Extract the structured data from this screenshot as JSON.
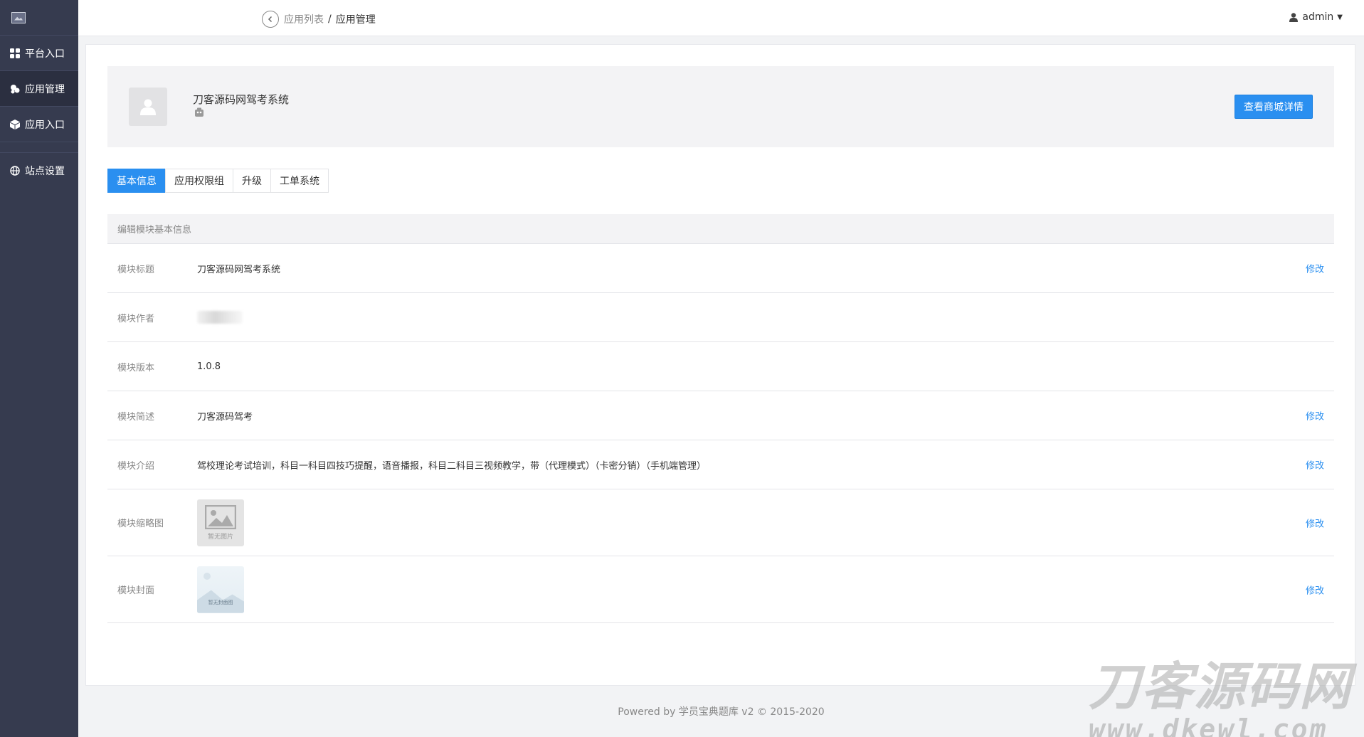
{
  "sidebar": {
    "logo_icon": "image-icon",
    "items": [
      {
        "label": "平台入口",
        "icon": "grid-icon",
        "active": false
      },
      {
        "label": "应用管理",
        "icon": "cubes-icon",
        "active": true
      },
      {
        "label": "应用入口",
        "icon": "cube-icon",
        "active": false
      },
      {
        "label": "站点设置",
        "icon": "globe-icon",
        "active": false
      }
    ]
  },
  "topbar": {
    "breadcrumb": {
      "back_icon": "chevron-left-circle-icon",
      "parent": "应用列表",
      "separator": "/",
      "current": "应用管理"
    },
    "user": {
      "name": "admin",
      "icon": "user-icon"
    }
  },
  "app": {
    "name": "刀客源码网驾考系统",
    "mall_button": "查看商城详情"
  },
  "tabs": [
    {
      "label": "基本信息",
      "active": true
    },
    {
      "label": "应用权限组",
      "active": false
    },
    {
      "label": "升级",
      "active": false
    },
    {
      "label": "工单系统",
      "active": false
    }
  ],
  "info": {
    "header": "编辑模块基本信息",
    "rows": [
      {
        "label": "模块标题",
        "value": "刀客源码网驾考系统",
        "action": "修改"
      },
      {
        "label": "模块作者",
        "value": "",
        "action": ""
      },
      {
        "label": "模块版本",
        "value": "1.0.8",
        "action": ""
      },
      {
        "label": "模块简述",
        "value": "刀客源码驾考",
        "action": "修改"
      },
      {
        "label": "模块介绍",
        "value": "驾校理论考试培训，科目一科目四技巧提醒，语音播报，科目二科目三视频教学，带（代理模式）（卡密分销）（手机端管理）",
        "action": "修改"
      },
      {
        "label": "模块缩略图",
        "thumb_text": "暂无图片",
        "action": "修改"
      },
      {
        "label": "模块封面",
        "cover_text": "暂无封面图",
        "action": "修改"
      }
    ]
  },
  "footer": "Powered by 学员宝典题库 v2 © 2015-2020",
  "watermark": {
    "title": "刀客源码网",
    "url": "www.dkewl.com"
  },
  "colors": {
    "sidebar_bg": "#363b4f",
    "accent": "#2a8ff0",
    "link": "#2a8ff0"
  }
}
